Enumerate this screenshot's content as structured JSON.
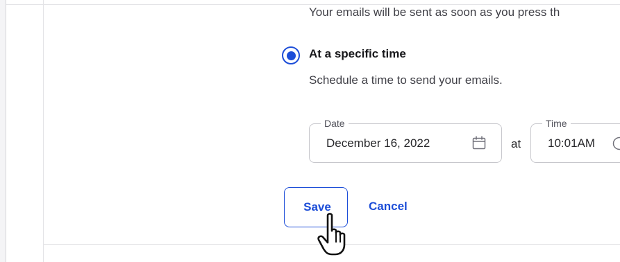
{
  "delivery": {
    "immediate_desc": "Your emails will be sent as soon as you press th",
    "scheduled": {
      "title": "At a specific time",
      "description": "Schedule a time to send your emails.",
      "selected": true
    }
  },
  "schedule_fields": {
    "date_label": "Date",
    "date_value": "December 16, 2022",
    "connector": "at",
    "time_label": "Time",
    "time_value": "10:01AM"
  },
  "actions": {
    "save_label": "Save",
    "cancel_label": "Cancel"
  },
  "colors": {
    "accent": "#1d4ed8",
    "text": "#27272a",
    "border": "#c7c7cc"
  },
  "icons": {
    "date_field": "calendar-icon",
    "time_field": "clock-icon",
    "pointer": "hand-pointer-icon"
  }
}
